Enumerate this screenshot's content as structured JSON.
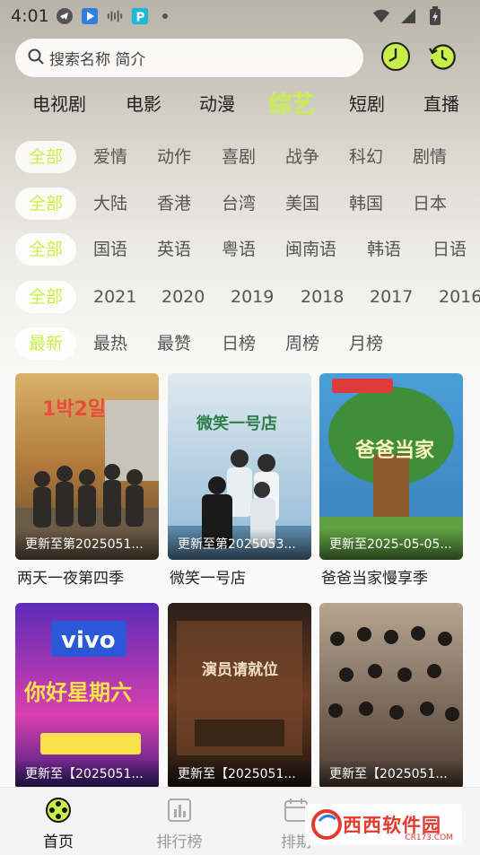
{
  "status_bar": {
    "time": "4:01"
  },
  "search": {
    "placeholder": "搜索名称 简介"
  },
  "category_tabs": [
    "电视剧",
    "电影",
    "动漫",
    "综艺",
    "短剧",
    "直播"
  ],
  "active_category": "综艺",
  "filters": {
    "genre": [
      "全部",
      "爱情",
      "动作",
      "喜剧",
      "战争",
      "科幻",
      "剧情"
    ],
    "region": [
      "全部",
      "大陆",
      "香港",
      "台湾",
      "美国",
      "韩国",
      "日本"
    ],
    "language": [
      "全部",
      "国语",
      "英语",
      "粤语",
      "闽南语",
      "韩语",
      "日语"
    ],
    "year": [
      "全部",
      "2021",
      "2020",
      "2019",
      "2018",
      "2017",
      "2016"
    ],
    "sort": [
      "最新",
      "最热",
      "最赞",
      "日榜",
      "周榜",
      "月榜"
    ]
  },
  "cards": [
    {
      "title": "两天一夜第四季",
      "status": "更新至第2025051...",
      "poster_text": "1박2일"
    },
    {
      "title": "微笑一号店",
      "status": "更新至第2025053...",
      "poster_text": "微笑一号店"
    },
    {
      "title": "爸爸当家慢享季",
      "status": "更新至2025-05-05...",
      "poster_text": "爸爸当家"
    },
    {
      "title": "",
      "status": "更新至【2025051...",
      "poster_text": "你好星期六"
    },
    {
      "title": "",
      "status": "更新至【2025051...",
      "poster_text": "演员请就位"
    },
    {
      "title": "",
      "status": "更新至【2025051...",
      "poster_text": ""
    }
  ],
  "bottom_nav": [
    {
      "label": "首页"
    },
    {
      "label": "排行榜"
    },
    {
      "label": "排期"
    }
  ],
  "watermark": {
    "text": "西西软件园",
    "sub": "CR173.COM"
  },
  "colors": {
    "accent": "#c9f04a"
  }
}
